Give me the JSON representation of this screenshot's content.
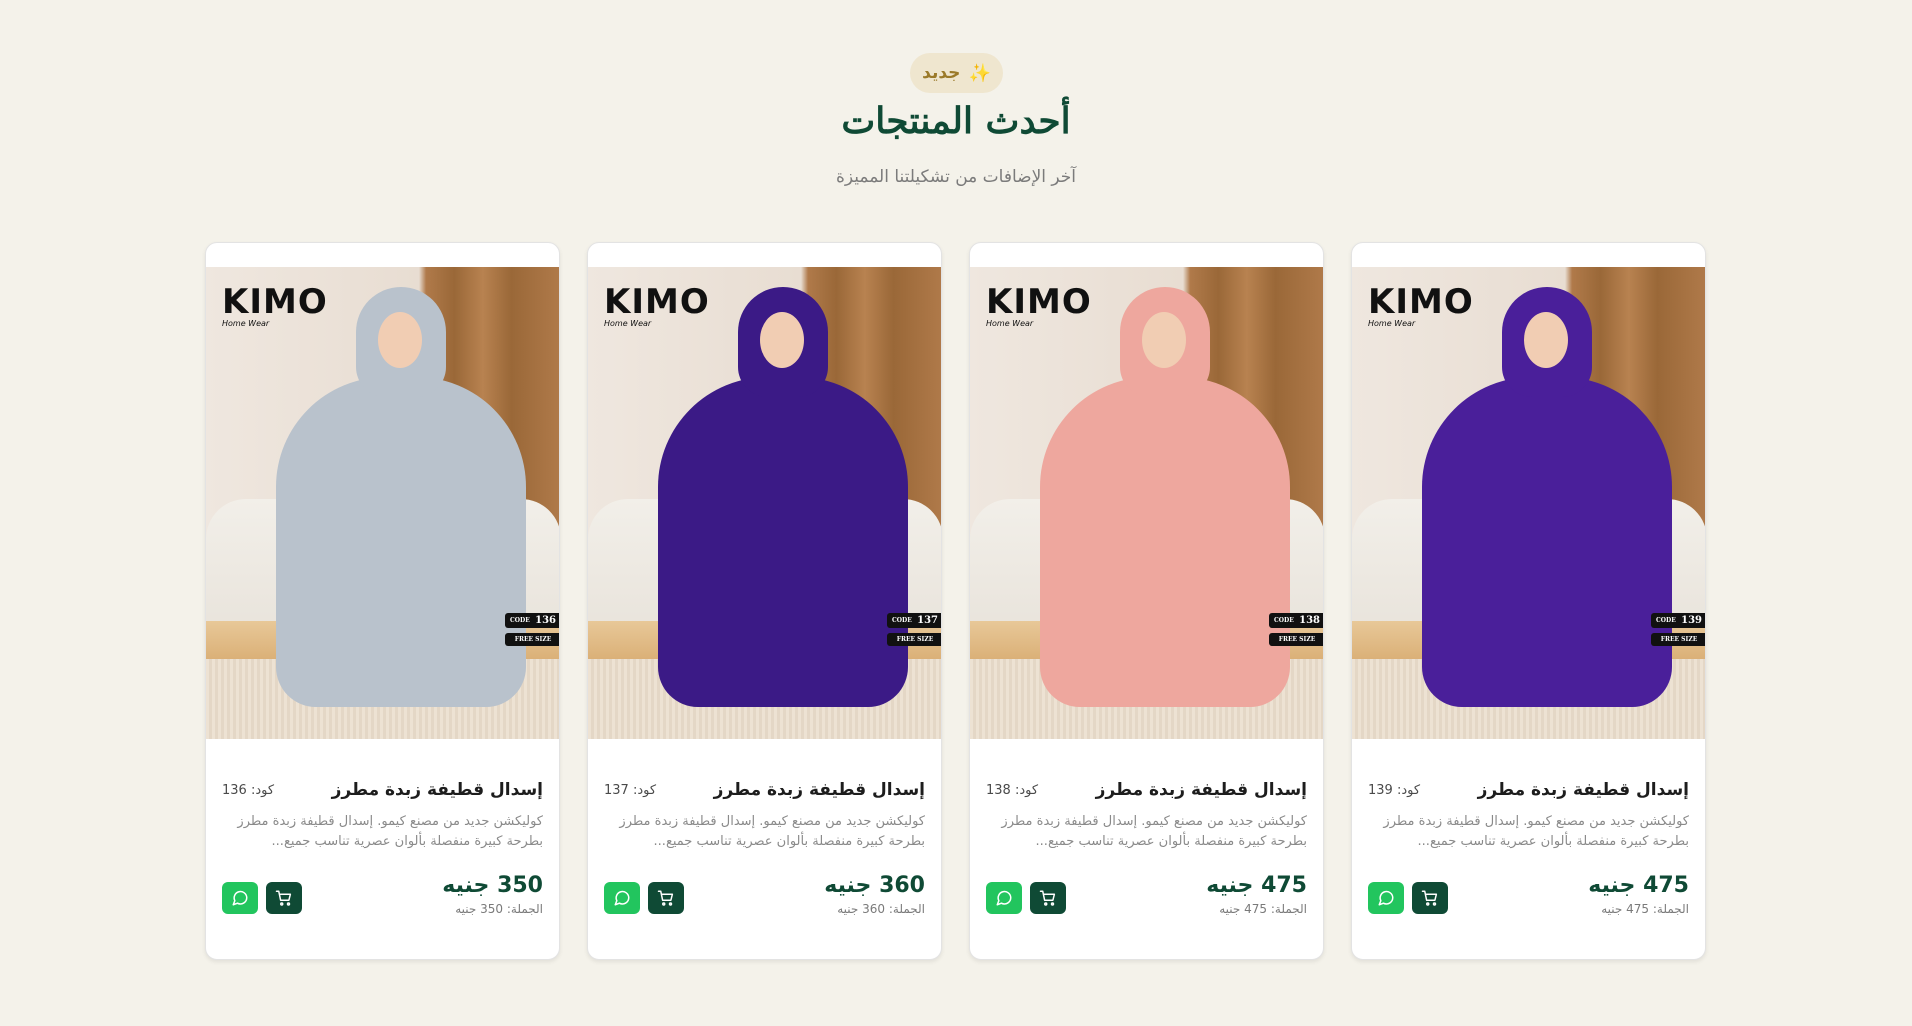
{
  "section": {
    "badge_label": "جديد",
    "title": "أحدث المنتجات",
    "subtitle": "آخر الإضافات من تشكيلتنا المميزة"
  },
  "brand": {
    "logo_text": "KIMO",
    "logo_sub": "Home Wear"
  },
  "products": [
    {
      "name": "إسدال قطيفة زبدة مطرز",
      "code": "كود: 139",
      "desc": "كوليكشن جديد من مصنع كيمو. إسدال قطيفة زبدة مطرز بطرحة كبيرة منفصلة بألوان عصرية تناسب جميع...",
      "price": "475 جنيه",
      "wholesale": "الجملة: 475 جنيه",
      "image_code": "139",
      "image_code_label": "CODE",
      "image_size_label": "FREE SIZE",
      "dress_color": "#4a1f9a"
    },
    {
      "name": "إسدال قطيفة زبدة مطرز",
      "code": "كود: 138",
      "desc": "كوليكشن جديد من مصنع كيمو. إسدال قطيفة زبدة مطرز بطرحة كبيرة منفصلة بألوان عصرية تناسب جميع...",
      "price": "475 جنيه",
      "wholesale": "الجملة: 475 جنيه",
      "image_code": "138",
      "image_code_label": "CODE",
      "image_size_label": "FREE SIZE",
      "dress_color": "#eea79e"
    },
    {
      "name": "إسدال قطيفة زبدة مطرز",
      "code": "كود: 137",
      "desc": "كوليكشن جديد من مصنع كيمو. إسدال قطيفة زبدة مطرز بطرحة كبيرة منفصلة بألوان عصرية تناسب جميع...",
      "price": "360 جنيه",
      "wholesale": "الجملة: 360 جنيه",
      "image_code": "137",
      "image_code_label": "CODE",
      "image_size_label": "FREE SIZE",
      "dress_color": "#3b1a86"
    },
    {
      "name": "إسدال قطيفة زبدة مطرز",
      "code": "كود: 136",
      "desc": "كوليكشن جديد من مصنع كيمو. إسدال قطيفة زبدة مطرز بطرحة كبيرة منفصلة بألوان عصرية تناسب جميع...",
      "price": "350 جنيه",
      "wholesale": "الجملة: 350 جنيه",
      "image_code": "136",
      "image_code_label": "CODE",
      "image_size_label": "FREE SIZE",
      "dress_color": "#b9c2cc"
    }
  ],
  "colors": {
    "primary": "#0f4a35",
    "whatsapp": "#22c55e",
    "badge_bg": "#efe6cf",
    "page_bg": "#f4f2ea"
  }
}
